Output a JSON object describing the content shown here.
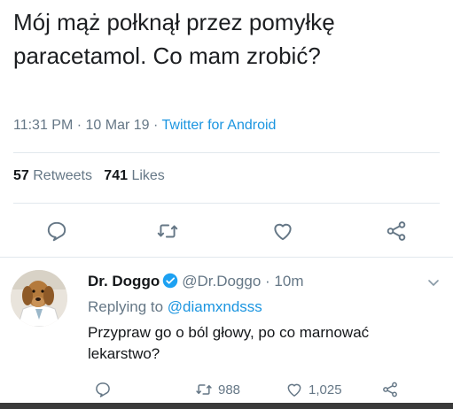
{
  "tweet": {
    "text_line1": "Mój mąż połknął przez pomyłkę",
    "text_line2": "paracetamol. Co mam zrobić?",
    "time": "11:31 PM",
    "sep1": " · ",
    "date": "10 Mar 19",
    "sep2": " · ",
    "source": "Twitter for Android",
    "retweets_count": "57",
    "retweets_label": "Retweets",
    "likes_count": "741",
    "likes_label": "Likes"
  },
  "reply": {
    "name": "Dr. Doggo",
    "handle": "@Dr.Doggo",
    "sep": " · ",
    "age": "10m",
    "replying_prefix": "Replying to ",
    "replying_to": "@diamxndsss",
    "text": "Przypraw go o ból głowy, po co marnować lekarstwo?",
    "retweets": "988",
    "likes": "1,025"
  },
  "colors": {
    "accent": "#1b95e0",
    "muted": "#657786",
    "text": "#14171a"
  },
  "icons": [
    "reply-icon",
    "retweet-icon",
    "like-icon",
    "share-icon",
    "verified-icon",
    "chevron-down-icon"
  ]
}
